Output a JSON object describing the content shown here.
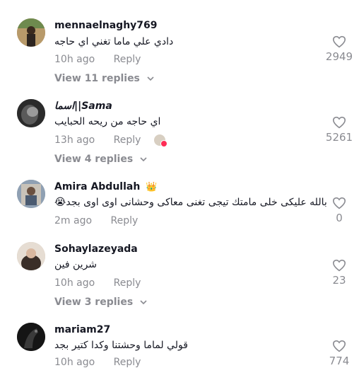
{
  "comments": [
    {
      "username": "mennaelnaghy769",
      "text": "دادي علي ماما تغني اي حاجه",
      "time": "10h ago",
      "reply_label": "Reply",
      "likes": "2949",
      "view_replies": "View 11 replies",
      "avatar_color": "#9b7a55"
    },
    {
      "username": "اسما||Sama",
      "text": "اي حاجه من ريحه الحبايب",
      "time": "13h ago",
      "reply_label": "Reply",
      "likes": "5261",
      "view_replies": "View 4 replies",
      "avatar_color": "#4a4a4a"
    },
    {
      "username": "Amira Abdullah",
      "badge": "👑",
      "text": "بالله عليكى خلى مامتك تيجى تغنى معاكى وحشانى اوى اوى بجد😭",
      "time": "2m ago",
      "reply_label": "Reply",
      "likes": "0",
      "avatar_color": "#7c8fa3"
    },
    {
      "username": "Sohaylazeyada",
      "text": "شرين فين",
      "time": "10h ago",
      "reply_label": "Reply",
      "likes": "23",
      "view_replies": "View 3 replies",
      "avatar_color": "#c9b8a6"
    },
    {
      "username": "mariam27",
      "text": "قولي لماما وحشتنا وكدا كتير بجد",
      "time": "10h ago",
      "reply_label": "Reply",
      "likes": "774",
      "avatar_color": "#1c1c1c"
    }
  ]
}
